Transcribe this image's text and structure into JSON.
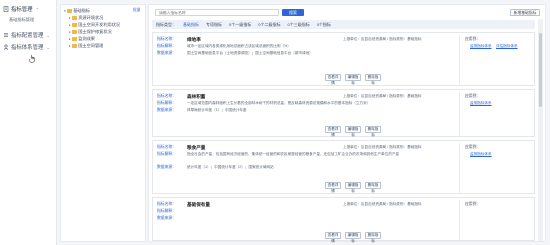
{
  "nav": {
    "items": [
      {
        "label": "指标管理",
        "caret": "⌃"
      },
      {
        "label": "指标配置管理",
        "caret": "⌄"
      },
      {
        "label": "指标体系管理",
        "caret": "⌄"
      }
    ],
    "sub": "基础指标管理"
  },
  "tree": {
    "action": "批量",
    "rows": [
      {
        "label": "基础指标",
        "toggle": "▾"
      },
      {
        "label": "资源环境状况",
        "toggle": "▸"
      },
      {
        "label": "国土空间开发利用状况",
        "toggle": "▸"
      },
      {
        "label": "国土保护修复状况",
        "toggle": "▸"
      },
      {
        "label": "监测成果",
        "toggle": "▸"
      },
      {
        "label": "国土空间管理",
        "toggle": "▸"
      }
    ]
  },
  "main": {
    "search_placeholder": "请输入指标名称",
    "search_button": "搜索",
    "add_button": "新增基础指标",
    "filters": [
      "指标类型：",
      "基础指标",
      "专项指标",
      "0个一级指标",
      "0个二级指标",
      "0个三级指标",
      "0个指标"
    ],
    "labels": {
      "name": "指标名称：",
      "def": "指标解释：",
      "source": "数据来源：",
      "apply": "应用到："
    },
    "buttons": {
      "view": "查看详情",
      "edit": "编辑指标",
      "delete": "删除指标"
    },
    "cards": [
      {
        "name": "绿地率",
        "meta": "上报单位：区县自然资源局 / 指标类别：基础指标",
        "def": "城市一定区域内各类绿化用地总面积占该区域总面积的比例（%）",
        "src": "国土空间基础信息平台（土地资源调查）；国土空间基础信息平台（城市绿地）",
        "links": [
          "监测指标体系",
          "评估指标体系"
        ]
      },
      {
        "name": "森林积蓄",
        "meta": "上报单位：区县自然资源局 / 指标类别：基础指标",
        "def": "一定区域范围内森林面积上生长着的全部林木树干的材积总量，是反映森林资源总规模和水平的基本指标（立方米）",
        "src": "林草局统计年鉴（1）；中国统计年鉴",
        "links": [
          "监测指标体系"
        ]
      },
      {
        "name": "粮食产量",
        "meta": "上报单位：区县自然资源局 / 指标类别：基础指标",
        "def": "指全社会的产量，包括国有经济经营的、集体统一经营的和农民家庭经营的粮食产量，还包括工矿企业办的农场和其他生产单位的产量",
        "src": "统计年鉴（1）；中国统计年鉴（2）；国家统计局网站",
        "links": [
          "监测指标体系"
        ]
      },
      {
        "name": "基础保有量",
        "meta": "上报单位：区县自然资源局 / 指标类别：基础指标",
        "def": "",
        "src": "",
        "links": []
      }
    ]
  },
  "colors": {
    "accent": "#2b67d8",
    "folder": "#f0b94a"
  }
}
